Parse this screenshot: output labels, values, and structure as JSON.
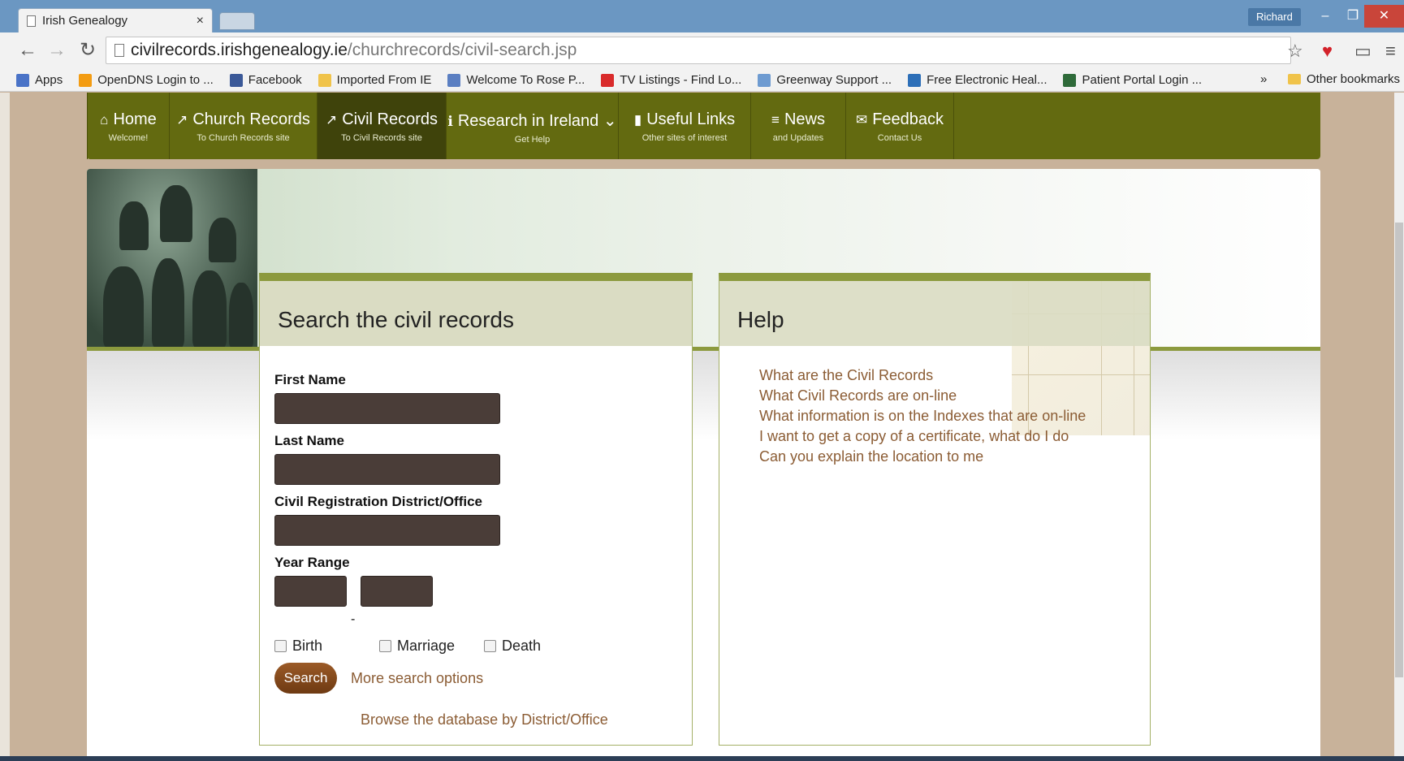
{
  "browser": {
    "tab_title": "Irish Genealogy",
    "tab_close": "×",
    "profile_name": "Richard",
    "window": {
      "minimize": "–",
      "restore": "❐",
      "close": "✕"
    },
    "url_host": "civilrecords.irishgenealogy.ie",
    "url_path": "/churchrecords/civil-search.jsp",
    "bookmarks": [
      {
        "label": "Apps",
        "icon": "apps-grid-icon",
        "color": "#4a73c7"
      },
      {
        "label": "OpenDNS Login to ...",
        "icon": "opendns-icon",
        "color": "#f39c12"
      },
      {
        "label": "Facebook",
        "icon": "facebook-icon",
        "color": "#3b5998"
      },
      {
        "label": "Imported From IE",
        "icon": "folder-icon",
        "color": "#f0c34a"
      },
      {
        "label": "Welcome To Rose P...",
        "icon": "rose-icon",
        "color": "#5b7fc2"
      },
      {
        "label": "TV Listings - Find Lo...",
        "icon": "tv-guide-icon",
        "color": "#d92b2b"
      },
      {
        "label": "Greenway Support ...",
        "icon": "cloud-icon",
        "color": "#6e9bd1"
      },
      {
        "label": "Free Electronic Heal...",
        "icon": "health-icon",
        "color": "#2d6fb8"
      },
      {
        "label": "Patient Portal Login ...",
        "icon": "portal-icon",
        "color": "#2f6b3a"
      }
    ],
    "bookmarks_overflow": "»",
    "other_bookmarks": "Other bookmarks"
  },
  "nav": {
    "items": [
      {
        "icon": "home-icon",
        "glyph": "⌂",
        "label": "Home",
        "sub": "Welcome!",
        "active": false
      },
      {
        "icon": "external-link-icon",
        "glyph": "↗",
        "label": "Church Records",
        "sub": "To Church Records site",
        "active": false
      },
      {
        "icon": "external-link-icon",
        "glyph": "↗",
        "label": "Civil Records",
        "sub": "To Civil Records site",
        "active": true
      },
      {
        "icon": "info-icon",
        "glyph": "ℹ",
        "label": "Research in Ireland",
        "sub": "Get Help",
        "active": false
      },
      {
        "icon": "bookmark-icon",
        "glyph": "▮",
        "label": "Useful Links",
        "sub": "Other sites of interest",
        "active": false
      },
      {
        "icon": "list-icon",
        "glyph": "≡",
        "label": "News",
        "sub": "and Updates",
        "active": false
      },
      {
        "icon": "envelope-icon",
        "glyph": "✉",
        "label": "Feedback",
        "sub": "Contact Us",
        "active": false
      }
    ]
  },
  "search": {
    "title": "Search the civil records",
    "first_name_label": "First Name",
    "last_name_label": "Last Name",
    "district_label": "Civil Registration District/Office",
    "year_range_label": "Year Range",
    "year_dash": "-",
    "types": [
      "Birth",
      "Marriage",
      "Death"
    ],
    "search_button": "Search",
    "more_options": "More search options",
    "browse_link": "Browse the database by District/Office"
  },
  "help": {
    "title": "Help",
    "links": [
      "What are the Civil Records",
      "What Civil Records are on-line",
      "What information is on the Indexes that are on-line",
      "I want to get a copy of a certificate, what do I do",
      "Can you explain the location to me"
    ]
  },
  "colors": {
    "nav_bg": "#636a10",
    "nav_active": "#3f430b",
    "accent": "#8c9a3e",
    "link": "#8b5c34",
    "input_bg": "#4a3d38"
  }
}
